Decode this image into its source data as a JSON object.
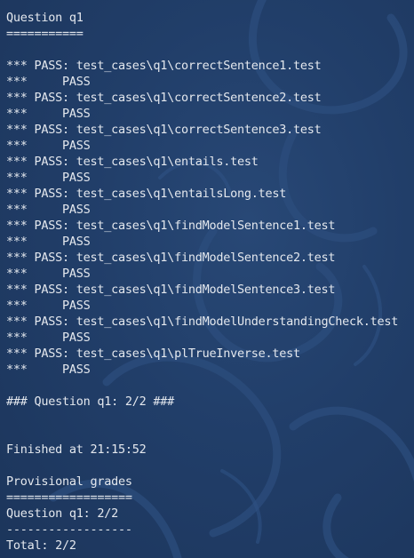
{
  "terminal": {
    "lines": [
      "Question q1",
      "===========",
      "",
      "*** PASS: test_cases\\q1\\correctSentence1.test",
      "***     PASS",
      "*** PASS: test_cases\\q1\\correctSentence2.test",
      "***     PASS",
      "*** PASS: test_cases\\q1\\correctSentence3.test",
      "***     PASS",
      "*** PASS: test_cases\\q1\\entails.test",
      "***     PASS",
      "*** PASS: test_cases\\q1\\entailsLong.test",
      "***     PASS",
      "*** PASS: test_cases\\q1\\findModelSentence1.test",
      "***     PASS",
      "*** PASS: test_cases\\q1\\findModelSentence2.test",
      "***     PASS",
      "*** PASS: test_cases\\q1\\findModelSentence3.test",
      "***     PASS",
      "*** PASS: test_cases\\q1\\findModelUnderstandingCheck.test",
      "***     PASS",
      "*** PASS: test_cases\\q1\\plTrueInverse.test",
      "***     PASS",
      "",
      "### Question q1: 2/2 ###",
      "",
      "",
      "Finished at 21:15:52",
      "",
      "Provisional grades",
      "==================",
      "Question q1: 2/2",
      "------------------",
      "Total: 2/2"
    ]
  }
}
